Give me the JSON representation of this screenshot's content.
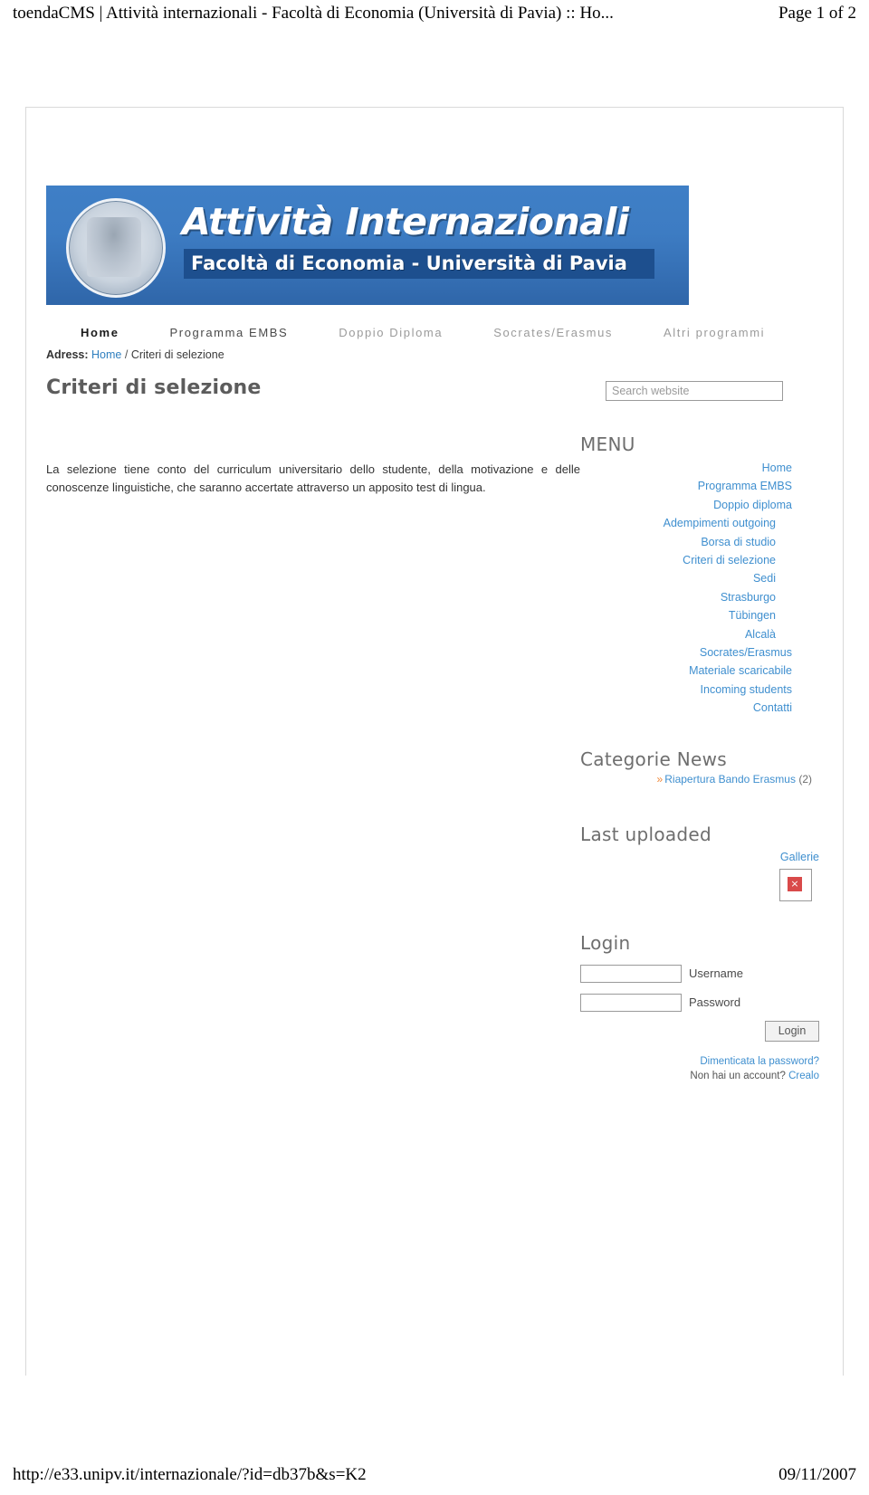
{
  "print": {
    "header_title": "toendaCMS | Attività internazionali - Facoltà di Economia (Università di Pavia) :: Ho...",
    "header_page": "Page 1 of 2",
    "footer_url": "http://e33.unipv.it/internazionale/?id=db37b&s=K2",
    "footer_date": "09/11/2007"
  },
  "banner": {
    "title_main": "Attività Internazionali",
    "title_sub": "Facoltà di Economia - Università di Pavia"
  },
  "topnav": [
    {
      "label": "Home",
      "state": "active"
    },
    {
      "label": "Programma EMBS",
      "state": "normal"
    },
    {
      "label": "Doppio Diploma",
      "state": "dim"
    },
    {
      "label": "Socrates/Erasmus",
      "state": "dim"
    },
    {
      "label": "Altri programmi",
      "state": "dim"
    }
  ],
  "breadcrumb": {
    "label": "Adress:",
    "home": "Home",
    "separator": "/",
    "current": "Criteri di selezione"
  },
  "page_title": "Criteri di selezione",
  "content": {
    "paragraph": "La selezione tiene conto del curriculum universitario dello studente, della motivazione e delle conoscenze linguistiche, che saranno accertate attraverso un apposito test di lingua."
  },
  "search": {
    "placeholder": "Search website",
    "value": ""
  },
  "sidebar": {
    "menu_heading": "MENU",
    "menu_items": [
      {
        "label": "Home",
        "level": 0
      },
      {
        "label": "Programma EMBS",
        "level": 0
      },
      {
        "label": "Doppio diploma",
        "level": 0
      },
      {
        "label": "Adempimenti outgoing",
        "level": 1
      },
      {
        "label": "Borsa di studio",
        "level": 1
      },
      {
        "label": "Criteri di selezione",
        "level": 1
      },
      {
        "label": "Sedi",
        "level": 1
      },
      {
        "label": "Strasburgo",
        "level": 1
      },
      {
        "label": "Tübingen",
        "level": 1
      },
      {
        "label": "Alcalà",
        "level": 1
      },
      {
        "label": "Socrates/Erasmus",
        "level": 0
      },
      {
        "label": "Materiale scaricabile",
        "level": 0
      },
      {
        "label": "Incoming students",
        "level": 0
      },
      {
        "label": "Contatti",
        "level": 0
      }
    ],
    "news_heading": "Categorie News",
    "news_items": [
      {
        "bullet": "»",
        "label": "Riapertura Bando Erasmus",
        "count": "(2)"
      }
    ],
    "uploaded_heading": "Last uploaded",
    "gallery_label": "Gallerie",
    "broken_image_glyph": "×",
    "login_heading": "Login",
    "username_label": "Username",
    "password_label": "Password",
    "username_value": "",
    "password_value": "",
    "login_button": "Login",
    "forgot_password": "Dimenticata la password?",
    "no_account_text": "Non hai un account?",
    "create_link": "Crealo"
  }
}
